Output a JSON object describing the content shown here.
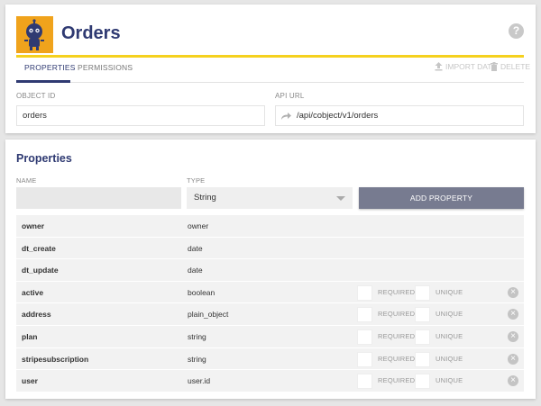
{
  "header": {
    "title": "Orders",
    "help_glyph": "?",
    "logo_icon": "robot-icon"
  },
  "tabs": [
    {
      "label": "PROPERTIES",
      "active": true
    },
    {
      "label": "PERMISSIONS",
      "active": false
    }
  ],
  "actions": {
    "import_label": "IMPORT DATA",
    "delete_label": "DELETE"
  },
  "fields": {
    "object_id_label": "OBJECT ID",
    "object_id_value": "orders",
    "api_url_label": "API URL",
    "api_url_value": "/api/cobject/v1/orders"
  },
  "properties": {
    "title": "Properties",
    "name_label": "NAME",
    "type_label": "TYPE",
    "type_selected": "String",
    "add_button_label": "ADD PROPERTY",
    "required_label": "REQUIRED",
    "unique_label": "UNIQUE",
    "rows": [
      {
        "name": "owner",
        "type": "owner",
        "editable": false
      },
      {
        "name": "dt_create",
        "type": "date",
        "editable": false
      },
      {
        "name": "dt_update",
        "type": "date",
        "editable": false
      },
      {
        "name": "active",
        "type": "boolean",
        "editable": true
      },
      {
        "name": "address",
        "type": "plain_object",
        "editable": true
      },
      {
        "name": "plan",
        "type": "string",
        "editable": true
      },
      {
        "name": "stripesubscription",
        "type": "string",
        "editable": true
      },
      {
        "name": "user",
        "type": "user.id",
        "editable": true
      }
    ]
  },
  "colors": {
    "accent_navy": "#2f3a72",
    "accent_yellow": "#f5d11e",
    "logo_orange": "#f0a31c",
    "button_gray": "#777b90"
  }
}
